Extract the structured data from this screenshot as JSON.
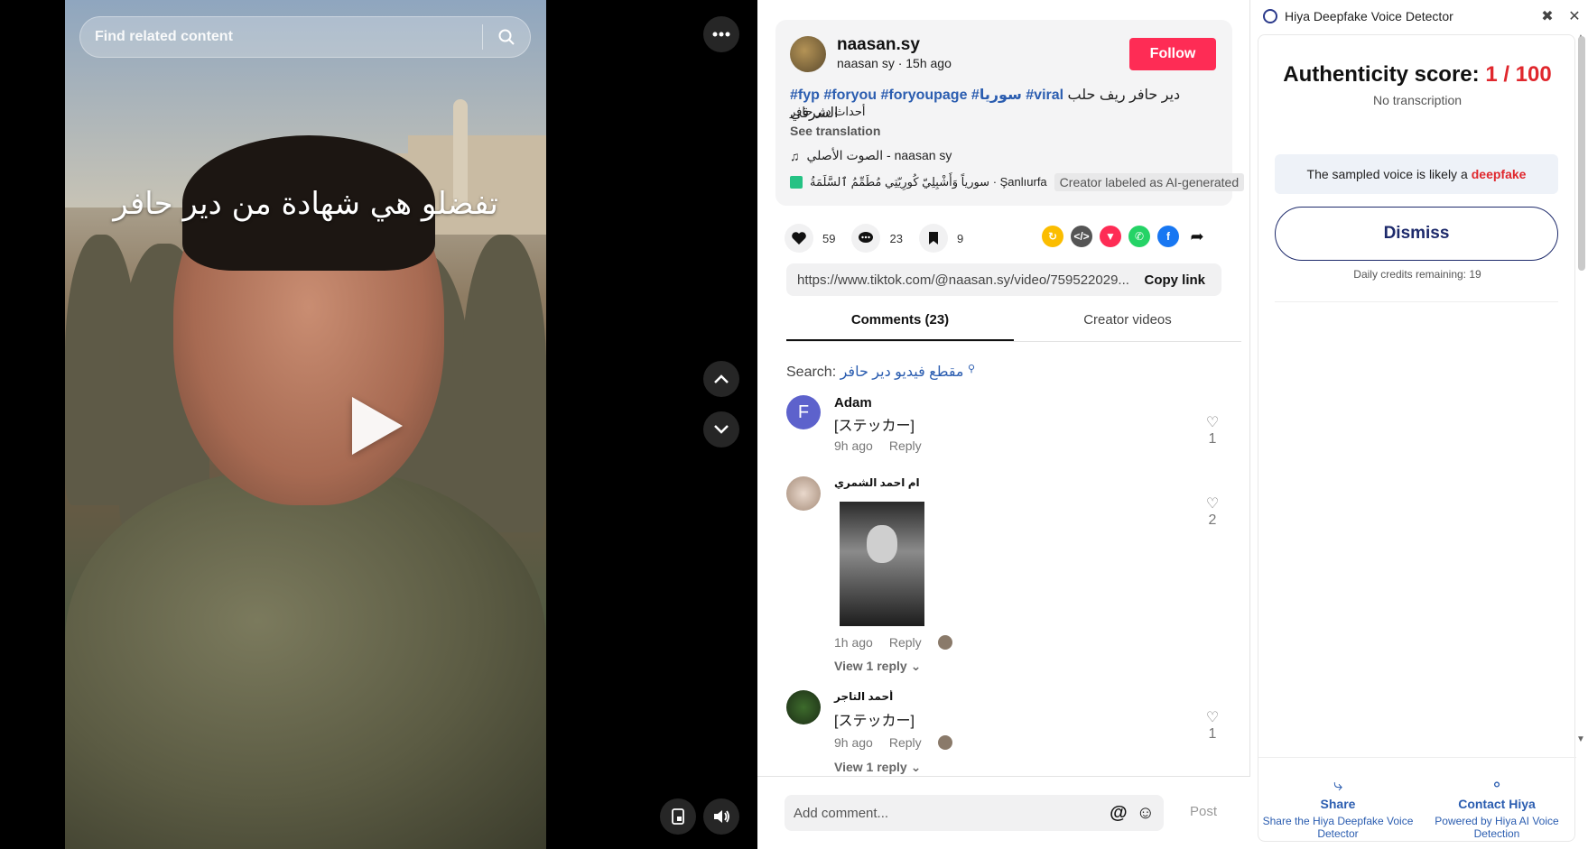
{
  "video": {
    "search_placeholder": "Find related content",
    "caption": "تفضلو هي شهادة من دير حافر"
  },
  "post": {
    "username": "naasan.sy",
    "subline": "naasan sy · 15h ago",
    "follow_label": "Follow",
    "hashtags": "#fyp #foryou #foryoupage #سوريا #viral",
    "desc_arabic_1": "دير حافر ريف حلب الشرقي",
    "desc_arabic_2": "أحداث دير حافر",
    "see_translation": "See translation",
    "music": "الصوت الأصلي - naasan sy",
    "location": "سورياً وَأَشْبِلِيّ كُورِيّتِي مُطَمِّمُ ٱلسَّلَمَةُ · Şanlıurfa",
    "ai_label": "Creator labeled as AI-generated"
  },
  "actions": {
    "likes": "59",
    "comments": "23",
    "saves": "9"
  },
  "share": {
    "url": "https://www.tiktok.com/@naasan.sy/video/759522029...",
    "copy_label": "Copy link"
  },
  "tabs": {
    "comments": "Comments (23)",
    "creator_videos": "Creator videos"
  },
  "comment_search": {
    "label": "Search:",
    "keyword": "مقطع فيديو دير حافر"
  },
  "comments": [
    {
      "name": "Adam",
      "avatar_letter": "F",
      "text": "[ステッカー]",
      "time": "9h ago",
      "reply": "Reply",
      "likes": "1"
    },
    {
      "name": "ام احمد الشمري",
      "text": "",
      "time": "1h ago",
      "reply": "Reply",
      "likes": "2",
      "view_reply": "View 1 reply"
    },
    {
      "name": "أحمد التاجر",
      "text": "[ステッカー]",
      "time": "9h ago",
      "reply": "Reply",
      "likes": "1",
      "view_reply": "View 1 reply"
    }
  ],
  "comment_input": {
    "placeholder": "Add comment...",
    "post_label": "Post"
  },
  "extension": {
    "title": "Hiya Deepfake Voice Detector",
    "score_label": "Authenticity score:",
    "score_value": "1 / 100",
    "no_transcription": "No transcription",
    "verdict_prefix": "The sampled voice is likely a",
    "verdict_word": "deepfake",
    "dismiss_label": "Dismiss",
    "credits": "Daily credits remaining: 19",
    "share_label": "Share",
    "share_sub": "Share the Hiya Deepfake Voice Detector",
    "contact_label": "Contact Hiya",
    "contact_sub": "Powered by Hiya AI Voice Detection"
  },
  "colors": {
    "follow": "#fe2c55",
    "hashtag": "#2b5db0",
    "score": "#e0272d",
    "hiya_blue": "#1d2a6b"
  }
}
